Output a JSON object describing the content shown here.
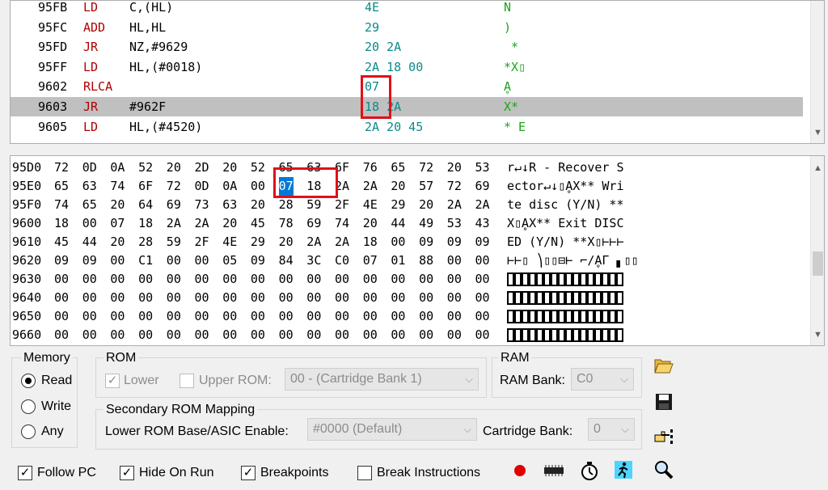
{
  "disasm": {
    "rows": [
      {
        "addr": "95FB",
        "mn": "LD",
        "op": "C,(HL)",
        "hex": "4E",
        "chr": "N"
      },
      {
        "addr": "95FC",
        "mn": "ADD",
        "op": "HL,HL",
        "hex": "29",
        "chr": ")"
      },
      {
        "addr": "95FD",
        "mn": "JR",
        "op": "NZ,#9629",
        "hex": "20 2A",
        "chr": " *"
      },
      {
        "addr": "95FF",
        "mn": "LD",
        "op": "HL,(#0018)",
        "hex": "2A 18 00",
        "chr": "*X▯"
      },
      {
        "addr": "9602",
        "mn": "RLCA",
        "op": "",
        "hex": "07",
        "chr": "Ḁ"
      },
      {
        "addr": "9603",
        "mn": "JR",
        "op": "#962F",
        "hex": "18 2A",
        "chr": "X*"
      },
      {
        "addr": "9605",
        "mn": "LD",
        "op": "HL,(#4520)",
        "hex": "2A 20 45",
        "chr": "* E"
      }
    ]
  },
  "memory": {
    "rows": [
      {
        "addr": "95D0",
        "bytes": [
          "72",
          "0D",
          "0A",
          "52",
          "20",
          "2D",
          "20",
          "52",
          "65",
          "63",
          "6F",
          "76",
          "65",
          "72",
          "20",
          "53"
        ],
        "chr": "r↵↓R - Recover S"
      },
      {
        "addr": "95E0",
        "bytes": [
          "65",
          "63",
          "74",
          "6F",
          "72",
          "0D",
          "0A",
          "00",
          "07",
          "18",
          "2A",
          "2A",
          "20",
          "57",
          "72",
          "69"
        ],
        "chr": "ector↵↓▯ḀX** Wri"
      },
      {
        "addr": "95F0",
        "bytes": [
          "74",
          "65",
          "20",
          "64",
          "69",
          "73",
          "63",
          "20",
          "28",
          "59",
          "2F",
          "4E",
          "29",
          "20",
          "2A",
          "2A"
        ],
        "chr": "te disc (Y/N) **"
      },
      {
        "addr": "9600",
        "bytes": [
          "18",
          "00",
          "07",
          "18",
          "2A",
          "2A",
          "20",
          "45",
          "78",
          "69",
          "74",
          "20",
          "44",
          "49",
          "53",
          "43"
        ],
        "chr": "X▯ḀX** Exit DISC"
      },
      {
        "addr": "9610",
        "bytes": [
          "45",
          "44",
          "20",
          "28",
          "59",
          "2F",
          "4E",
          "29",
          "20",
          "2A",
          "2A",
          "18",
          "00",
          "09",
          "09",
          "09"
        ],
        "chr": "ED (Y/N) **X▯⊢⊢⊢"
      },
      {
        "addr": "9620",
        "bytes": [
          "09",
          "09",
          "00",
          "C1",
          "00",
          "00",
          "05",
          "09",
          "84",
          "3C",
          "C0",
          "07",
          "01",
          "88",
          "00",
          "00"
        ],
        "chr": "⊢⊢▯ ⎞▯▯⊟⊢ ⌐∕ḀΓ ▖▯▯"
      },
      {
        "addr": "9630",
        "bytes": [
          "00",
          "00",
          "00",
          "00",
          "00",
          "00",
          "00",
          "00",
          "00",
          "00",
          "00",
          "00",
          "00",
          "00",
          "00",
          "00"
        ],
        "chr": ""
      },
      {
        "addr": "9640",
        "bytes": [
          "00",
          "00",
          "00",
          "00",
          "00",
          "00",
          "00",
          "00",
          "00",
          "00",
          "00",
          "00",
          "00",
          "00",
          "00",
          "00"
        ],
        "chr": ""
      },
      {
        "addr": "9650",
        "bytes": [
          "00",
          "00",
          "00",
          "00",
          "00",
          "00",
          "00",
          "00",
          "00",
          "00",
          "00",
          "00",
          "00",
          "00",
          "00",
          "00"
        ],
        "chr": ""
      },
      {
        "addr": "9660",
        "bytes": [
          "00",
          "00",
          "00",
          "00",
          "00",
          "00",
          "00",
          "00",
          "00",
          "00",
          "00",
          "00",
          "00",
          "00",
          "00",
          "00"
        ],
        "chr": ""
      }
    ]
  },
  "controls": {
    "memory_group": "Memory",
    "read": "Read",
    "write": "Write",
    "any": "Any",
    "rom_group": "ROM",
    "lower": "Lower",
    "upper_rom": "Upper ROM:",
    "upper_rom_value": "00 - (Cartridge Bank 1)",
    "ram_group": "RAM",
    "ram_bank": "RAM Bank:",
    "ram_bank_value": "C0",
    "secondary_group": "Secondary ROM Mapping",
    "lower_base": "Lower ROM Base/ASIC Enable:",
    "lower_base_value": "#0000 (Default)",
    "cart_bank": "Cartridge Bank:",
    "cart_bank_value": "0",
    "follow_pc": "Follow PC",
    "hide_on_run": "Hide On Run",
    "breakpoints": "Breakpoints",
    "break_instructions": "Break Instructions"
  },
  "colors": {
    "accent": "#0078d7",
    "highlight_box": "#e0101a",
    "mnemonic": "#b00000",
    "hex": "#0a8a8a",
    "chars": "#1aa51a"
  }
}
